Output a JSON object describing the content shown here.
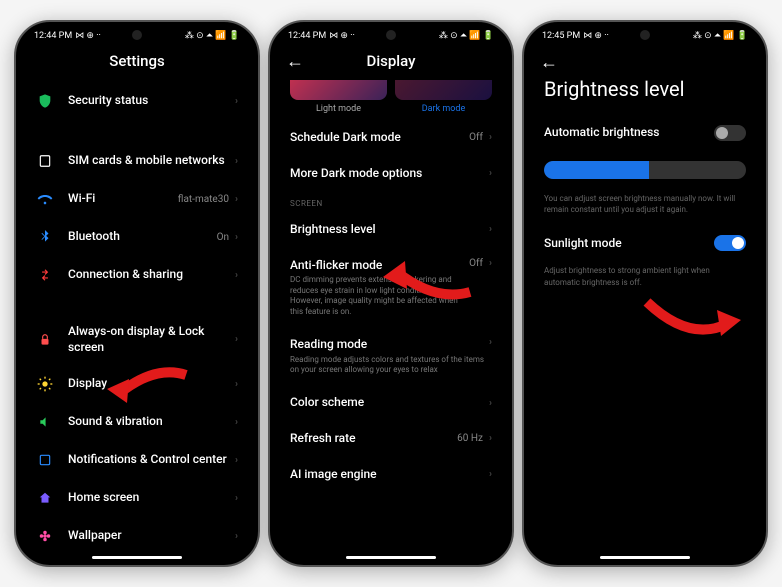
{
  "status": {
    "time1": "12:44 PM",
    "time2": "12:44 PM",
    "time3": "12:45 PM",
    "icons_left": "⋈ ⊕ ··",
    "icons_right": "⁂ ⊙ ⏶ 📶 🔋"
  },
  "screen1": {
    "title": "Settings",
    "items": [
      {
        "icon": "#1abc5c",
        "label": "Security status"
      },
      {
        "icon": "#ffffff",
        "label": "SIM cards & mobile networks"
      },
      {
        "icon": "#2a8cff",
        "label": "Wi-Fi",
        "value": "flat-mate30"
      },
      {
        "icon": "#2a8cff",
        "label": "Bluetooth",
        "value": "On"
      },
      {
        "icon": "#ff3b3b",
        "label": "Connection & sharing"
      },
      {
        "icon": "#ff4d4d",
        "label": "Always-on display & Lock screen"
      },
      {
        "icon": "#ffd633",
        "label": "Display"
      },
      {
        "icon": "#2acc5b",
        "label": "Sound & vibration"
      },
      {
        "icon": "#2a8cff",
        "label": "Notifications & Control center"
      },
      {
        "icon": "#7a5cff",
        "label": "Home screen"
      },
      {
        "icon": "#ff4da6",
        "label": "Wallpaper"
      }
    ]
  },
  "screen2": {
    "title": "Display",
    "light_label": "Light mode",
    "dark_label": "Dark mode",
    "section_screen": "SCREEN",
    "items": {
      "schedule": {
        "label": "Schedule Dark mode",
        "value": "Off"
      },
      "more_dark": {
        "label": "More Dark mode options"
      },
      "brightness": {
        "label": "Brightness level"
      },
      "antiflicker": {
        "label": "Anti-flicker mode",
        "sub": "DC dimming prevents extensive flickering and reduces eye strain in low light conditions. However, image quality might be affected when this feature is on.",
        "value": "Off"
      },
      "reading": {
        "label": "Reading mode",
        "sub": "Reading mode adjusts colors and textures of the items on your screen allowing your eyes to relax"
      },
      "colorscheme": {
        "label": "Color scheme"
      },
      "refresh": {
        "label": "Refresh rate",
        "value": "60 Hz"
      },
      "ai": {
        "label": "AI image engine"
      }
    }
  },
  "screen3": {
    "title": "Brightness level",
    "auto": "Automatic brightness",
    "auto_state": false,
    "slider_pct": 52,
    "hint1": "You can adjust screen brightness manually now. It will remain constant until you adjust it again.",
    "sunlight": "Sunlight mode",
    "sunlight_state": true,
    "hint2": "Adjust brightness to strong ambient light when automatic brightness is off."
  }
}
